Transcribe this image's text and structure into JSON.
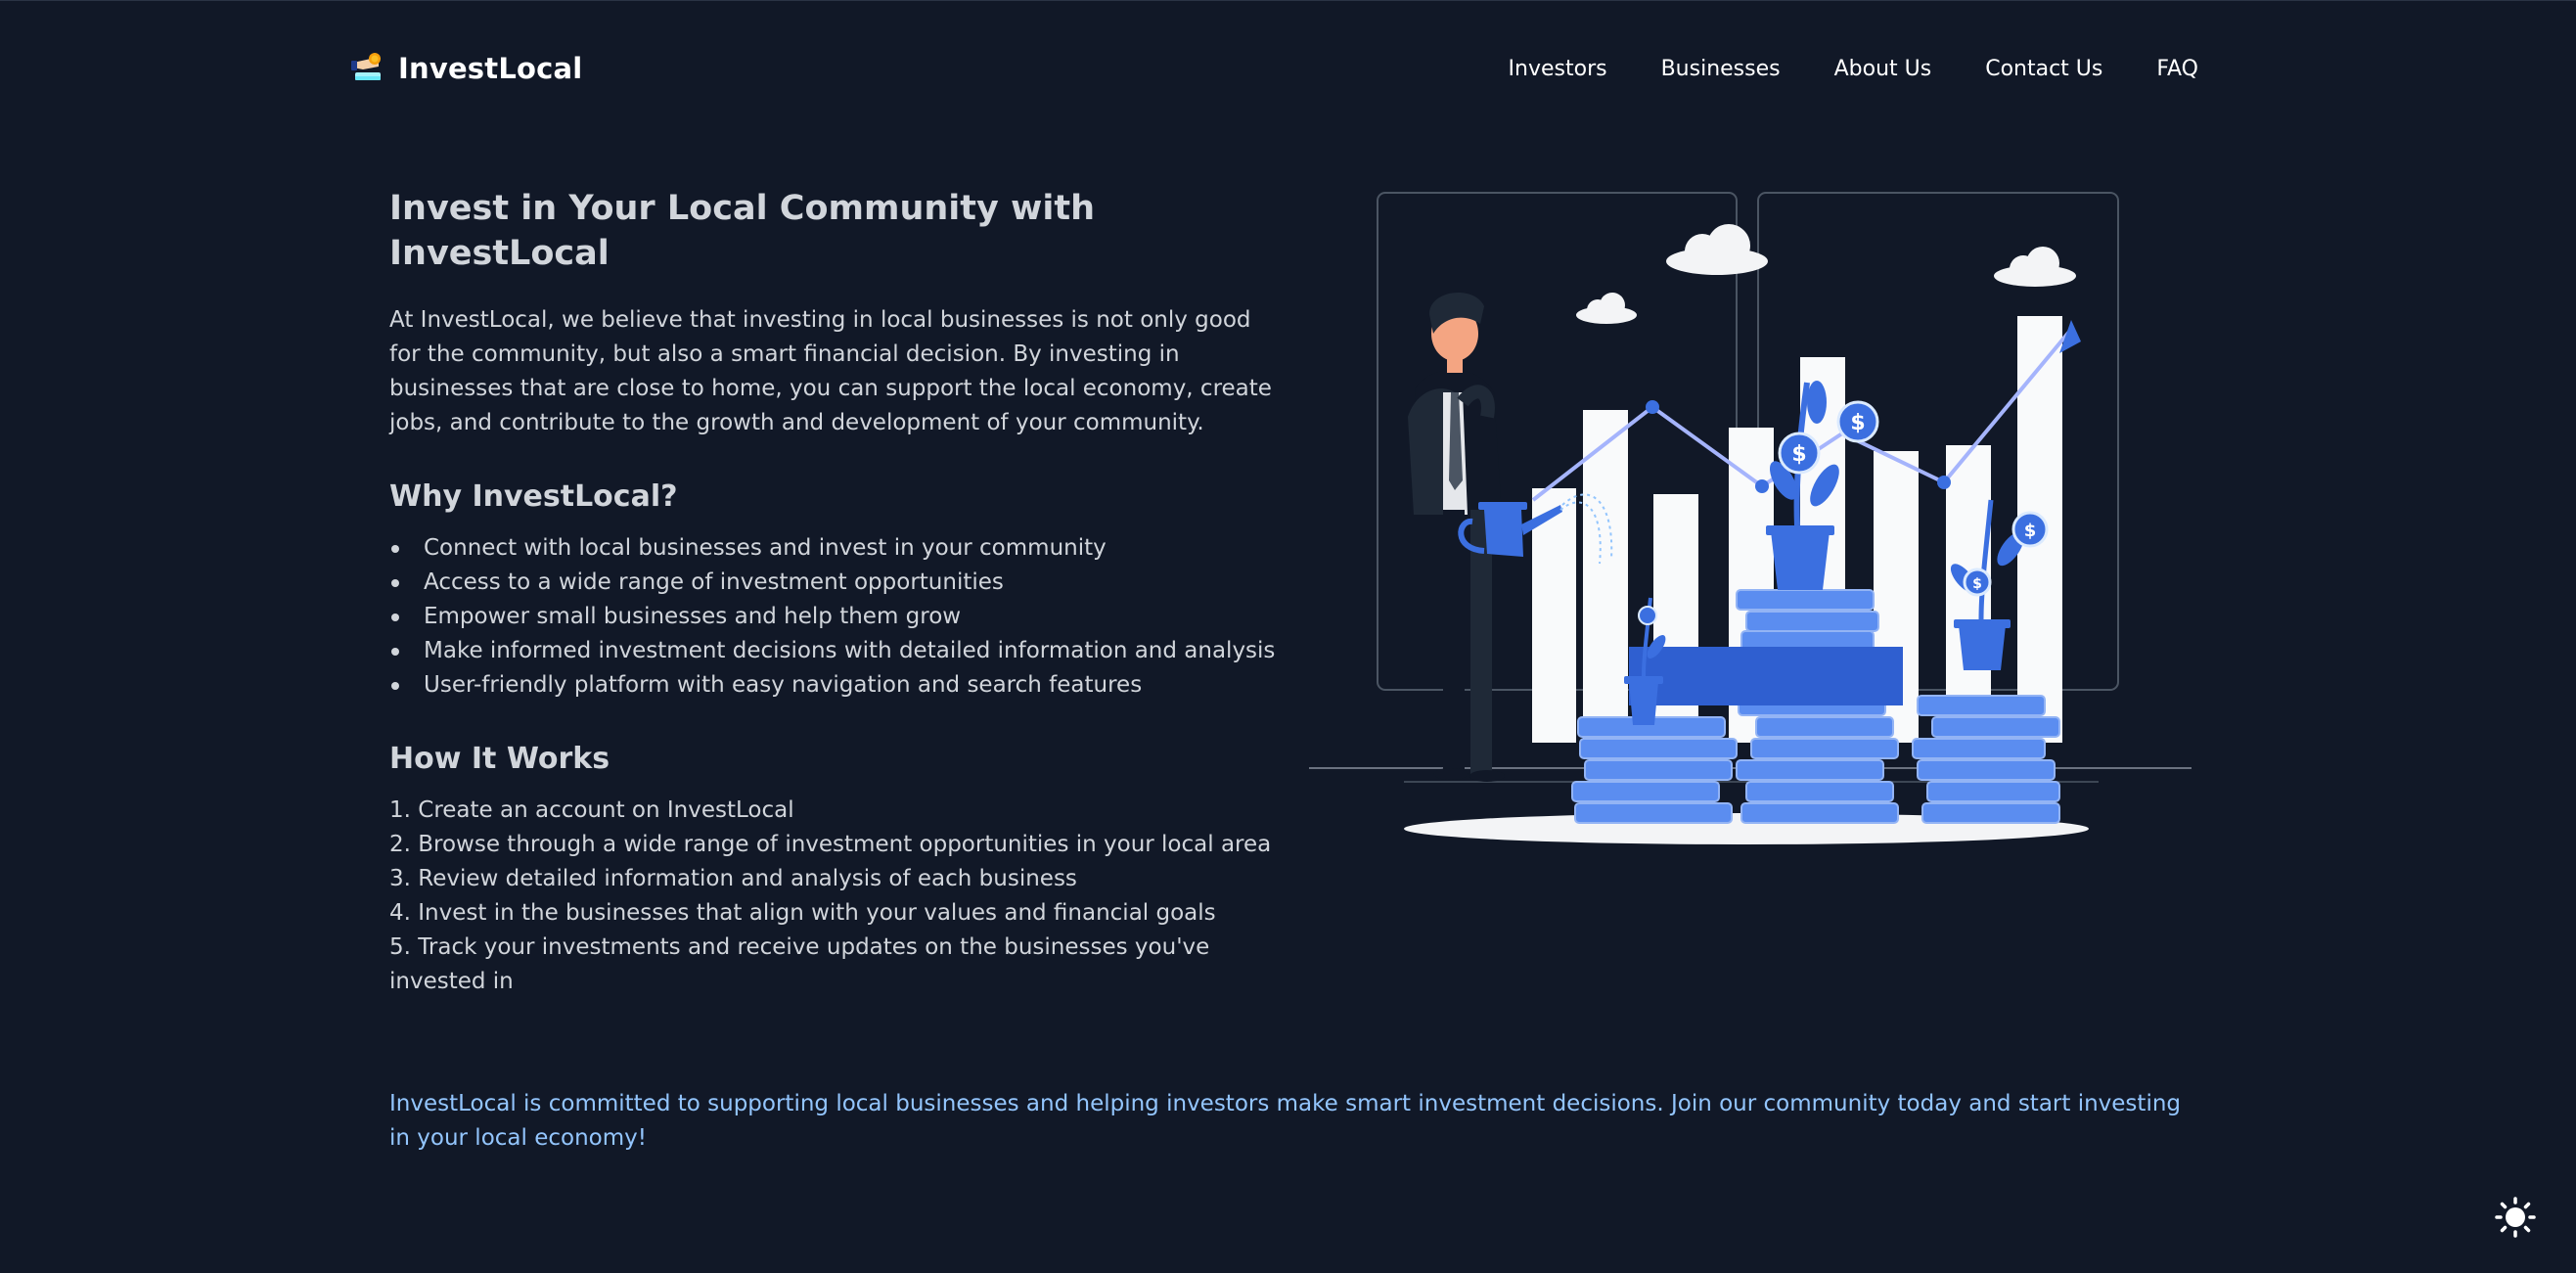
{
  "brand": {
    "name": "InvestLocal",
    "logo_icon": "hand-coins-icon"
  },
  "nav": {
    "items": [
      {
        "label": "Investors"
      },
      {
        "label": "Businesses"
      },
      {
        "label": "About Us"
      },
      {
        "label": "Contact Us"
      },
      {
        "label": "FAQ"
      }
    ]
  },
  "hero": {
    "title": "Invest in Your Local Community with InvestLocal",
    "intro": "At InvestLocal, we believe that investing in local businesses is not only good for the community, but also a smart financial decision. By investing in businesses that are close to home, you can support the local economy, create jobs, and contribute to the growth and development of your community."
  },
  "why": {
    "heading": "Why InvestLocal?",
    "items": [
      "Connect with local businesses and invest in your community",
      "Access to a wide range of investment opportunities",
      "Empower small businesses and help them grow",
      "Make informed investment decisions with detailed information and analysis",
      "User-friendly platform with easy navigation and search features"
    ]
  },
  "how": {
    "heading": "How It Works",
    "steps": [
      "1. Create an account on InvestLocal",
      "2. Browse through a wide range of investment opportunities in your local area",
      "3. Review detailed information and analysis of each business",
      "4. Invest in the businesses that align with your values and financial goals",
      "5. Track your investments and receive updates on the businesses you've invested in"
    ]
  },
  "commitment": "InvestLocal is committed to supporting local businesses and helping investors make smart investment decisions. Join our community today and start investing in your local economy!",
  "theme_toggle": {
    "icon": "sun-icon"
  },
  "colors": {
    "background": "#111827",
    "text": "#d1d5db",
    "accent": "#3b6fe0",
    "link_text": "#93c5fd"
  }
}
